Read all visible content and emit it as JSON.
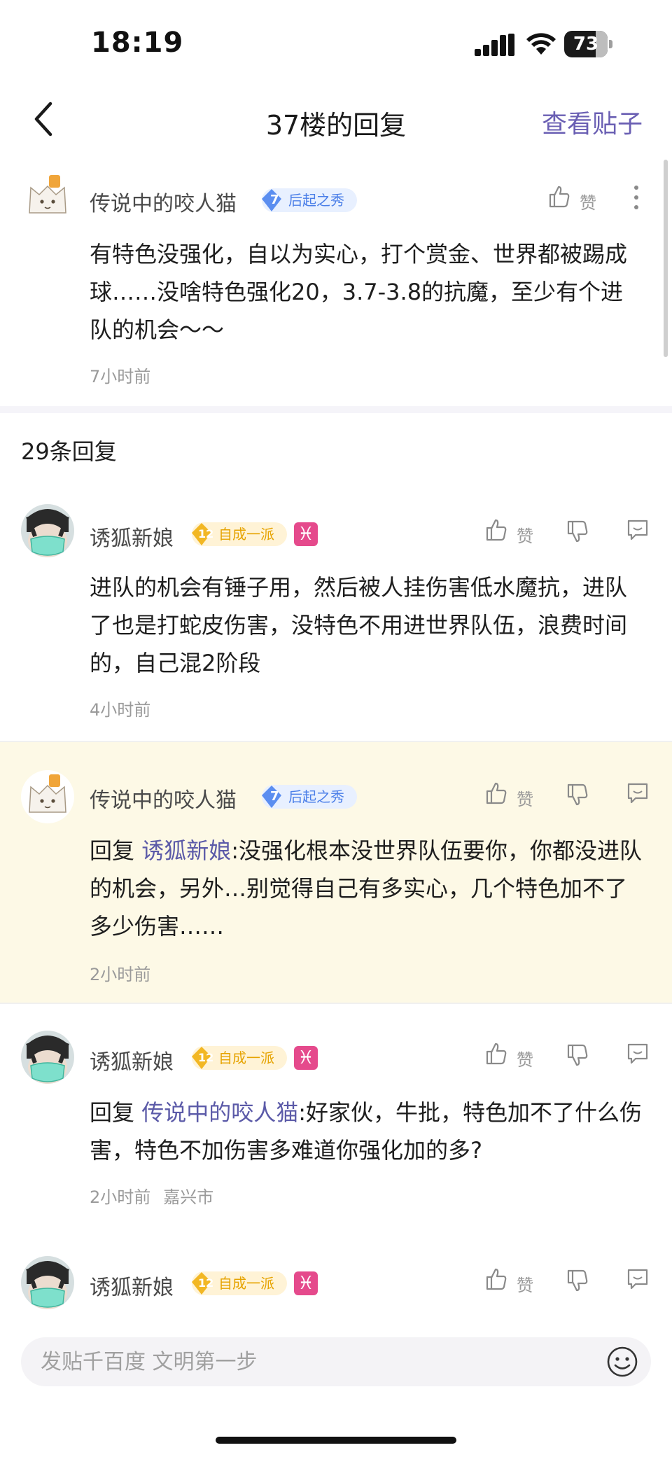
{
  "status_bar": {
    "time": "18:19",
    "battery": "73",
    "battery_fraction": 0.73
  },
  "nav": {
    "title": "37楼的回复",
    "action": "查看贴子"
  },
  "main_comment": {
    "username": "传说中的咬人猫",
    "level": "7",
    "badge": "后起之秀",
    "like_label": "赞",
    "text": "有特色没强化，自以为实心，打个赏金、世界都被踢成球……没啥特色强化20，3.7-3.8的抗魔，至少有个进队的机会～～",
    "time": "7小时前"
  },
  "replies_header": "29条回复",
  "replies": [
    {
      "username": "诱狐新娘",
      "level": "12",
      "badge": "自成一派",
      "zodiac": "♓",
      "like_label": "赞",
      "text": "进队的机会有锤子用，然后被人挂伤害低水魔抗，进队了也是打蛇皮伤害，没特色不用进世界队伍，浪费时间的，自己混2阶段",
      "time": "4小时前"
    },
    {
      "username": "传说中的咬人猫",
      "level": "7",
      "badge": "后起之秀",
      "like_label": "赞",
      "reply_prefix": "回复 ",
      "mention": "诱狐新娘",
      "text": ":没强化根本没世界队伍要你，你都没进队的机会，另外…别觉得自己有多实心，几个特色加不了多少伤害……",
      "time": "2小时前"
    },
    {
      "username": "诱狐新娘",
      "level": "12",
      "badge": "自成一派",
      "zodiac": "♓",
      "like_label": "赞",
      "reply_prefix": "回复 ",
      "mention": "传说中的咬人猫",
      "text": ":好家伙，牛批，特色加不了什么伤害，特色不加伤害多难道你强化加的多?",
      "time": "2小时前",
      "location": "嘉兴市"
    },
    {
      "username": "诱狐新娘",
      "level": "12",
      "badge": "自成一派",
      "zodiac": "♓",
      "like_label": "赞"
    }
  ],
  "composer": {
    "placeholder": "发贴千百度 文明第一步"
  },
  "colors": {
    "accent": "#6a5fb3",
    "highlight_bg": "#fdf9e6",
    "badge_blue": "#4a7ee8",
    "badge_gold": "#e6a300",
    "zodiac_pink": "#e54a8c"
  }
}
